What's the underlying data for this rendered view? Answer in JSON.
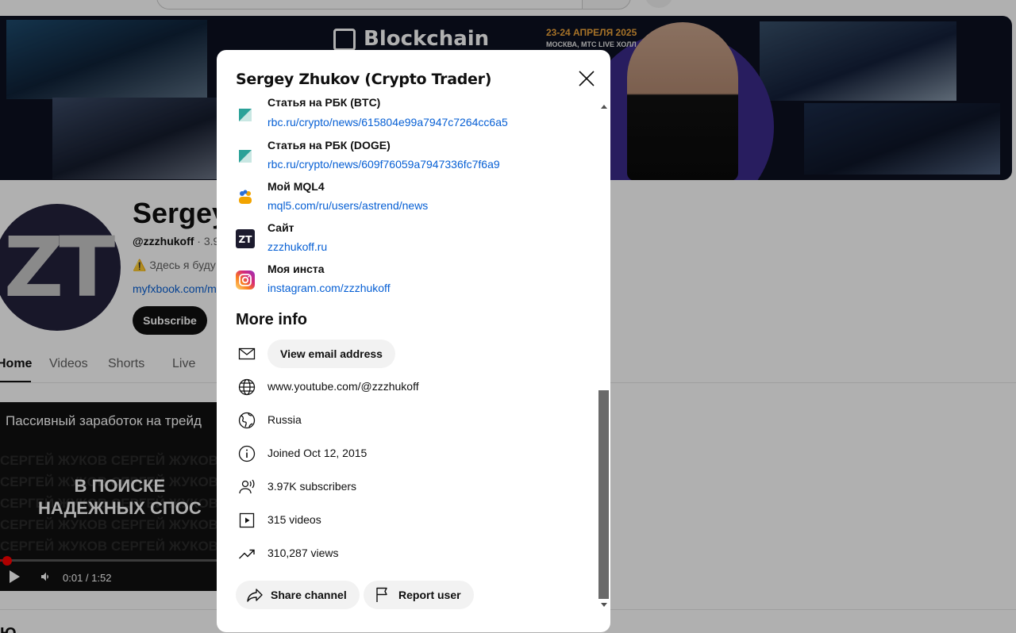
{
  "colors": {
    "link": "#065fd4",
    "accent_red": "#ff0000",
    "banner_date": "#f0a53a"
  },
  "banner": {
    "brand": "Blockchain",
    "date": "23-24 АПРЕЛЯ 2025",
    "venue": "МОСКВА, МТС LIVE ХОЛЛ"
  },
  "channel": {
    "avatar_text": "ZT",
    "name": "Sergey",
    "handle": "@zzzhukoff",
    "handle_meta": " · 3.9",
    "description": "⚠️ Здесь я буду",
    "link": "myfxbook.com/m",
    "subscribe_label": "Subscribe"
  },
  "tabs": [
    "Home",
    "Videos",
    "Shorts",
    "Live"
  ],
  "video": {
    "title": "Пассивный заработок на трейд",
    "background_text": "СЕРГЕЙ ЖУКОВ СЕРГЕЙ ЖУКОВ СЕРГЕЙ",
    "headline_line1": "В ПОИСКЕ",
    "headline_line2": "НАДЕЖНЫХ СПОС",
    "time": "0:01 / 1:52",
    "progress_fraction": 0.009
  },
  "dialog": {
    "title": "Sergey Zhukov (Crypto Trader)",
    "links": [
      {
        "title": "Статья на РБК (BTC)",
        "url": "rbc.ru/crypto/news/615804e99a7947c7264cc6a5",
        "icon": "rbc-icon"
      },
      {
        "title": "Статья на РБК (DOGE)",
        "url": "rbc.ru/crypto/news/609f76059a7947336fc7f6a9",
        "icon": "rbc-icon"
      },
      {
        "title": "Мой MQL4",
        "url": "mql5.com/ru/users/astrend/news",
        "icon": "mql5-icon"
      },
      {
        "title": "Сайт",
        "url": "zzzhukoff.ru",
        "icon": "zt-site-icon"
      },
      {
        "title": "Моя инста",
        "url": "instagram.com/zzzhukoff",
        "icon": "instagram-icon"
      }
    ],
    "more_info_heading": "More info",
    "email_button": "View email address",
    "channel_url": "www.youtube.com/@zzzhukoff",
    "country": "Russia",
    "joined": "Joined Oct 12, 2015",
    "subscribers": "3.97K subscribers",
    "videos": "315 videos",
    "views": "310,287 views",
    "share_button": "Share channel",
    "report_button": "Report user",
    "zt_icon_text": "ZT"
  }
}
